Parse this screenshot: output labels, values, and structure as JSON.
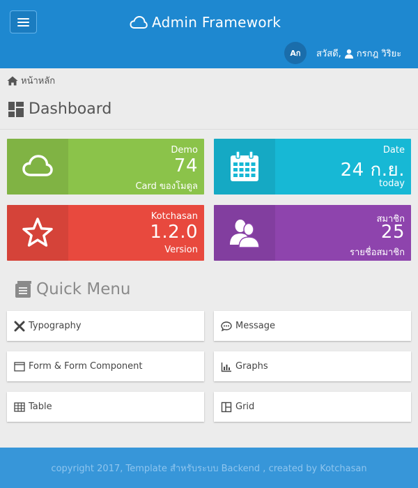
{
  "header": {
    "brand": "Admin Framework",
    "lang_button": "Aก",
    "greeting": "สวัสดี,",
    "user_name": "กรกฎ วิริยะ",
    "colors": {
      "header_bg": "#1e88d0",
      "icon": "cloud-icon"
    }
  },
  "breadcrumb": {
    "home_label": "หน้าหลัก"
  },
  "page": {
    "title": "Dashboard"
  },
  "cards": [
    {
      "label": "Demo",
      "value": "74",
      "sub": "Card ของโมดูล",
      "icon": "cloud-icon",
      "color": "#8bc34a"
    },
    {
      "label": "Date",
      "value": "24 ก.ย.",
      "sub": "today",
      "icon": "calendar-icon",
      "color": "#17b8d5"
    },
    {
      "label": "Kotchasan",
      "value": "1.2.0",
      "sub": "Version",
      "icon": "star-icon",
      "color": "#e8493e"
    },
    {
      "label": "สมาชิก",
      "value": "25",
      "sub": "รายชื่อสมาชิก",
      "icon": "users-icon",
      "color": "#8e44ad"
    }
  ],
  "quick_menu": {
    "title": "Quick Menu",
    "items": [
      {
        "label": "Typography",
        "icon": "tools-icon"
      },
      {
        "label": "Message",
        "icon": "message-icon"
      },
      {
        "label": "Form & Form Component",
        "icon": "form-icon"
      },
      {
        "label": "Graphs",
        "icon": "graph-icon"
      },
      {
        "label": "Table",
        "icon": "table-icon"
      },
      {
        "label": "Grid",
        "icon": "grid-icon"
      }
    ]
  },
  "footer": {
    "text": "copyright 2017, Template สำหรับระบบ Backend , created by Kotchasan"
  }
}
